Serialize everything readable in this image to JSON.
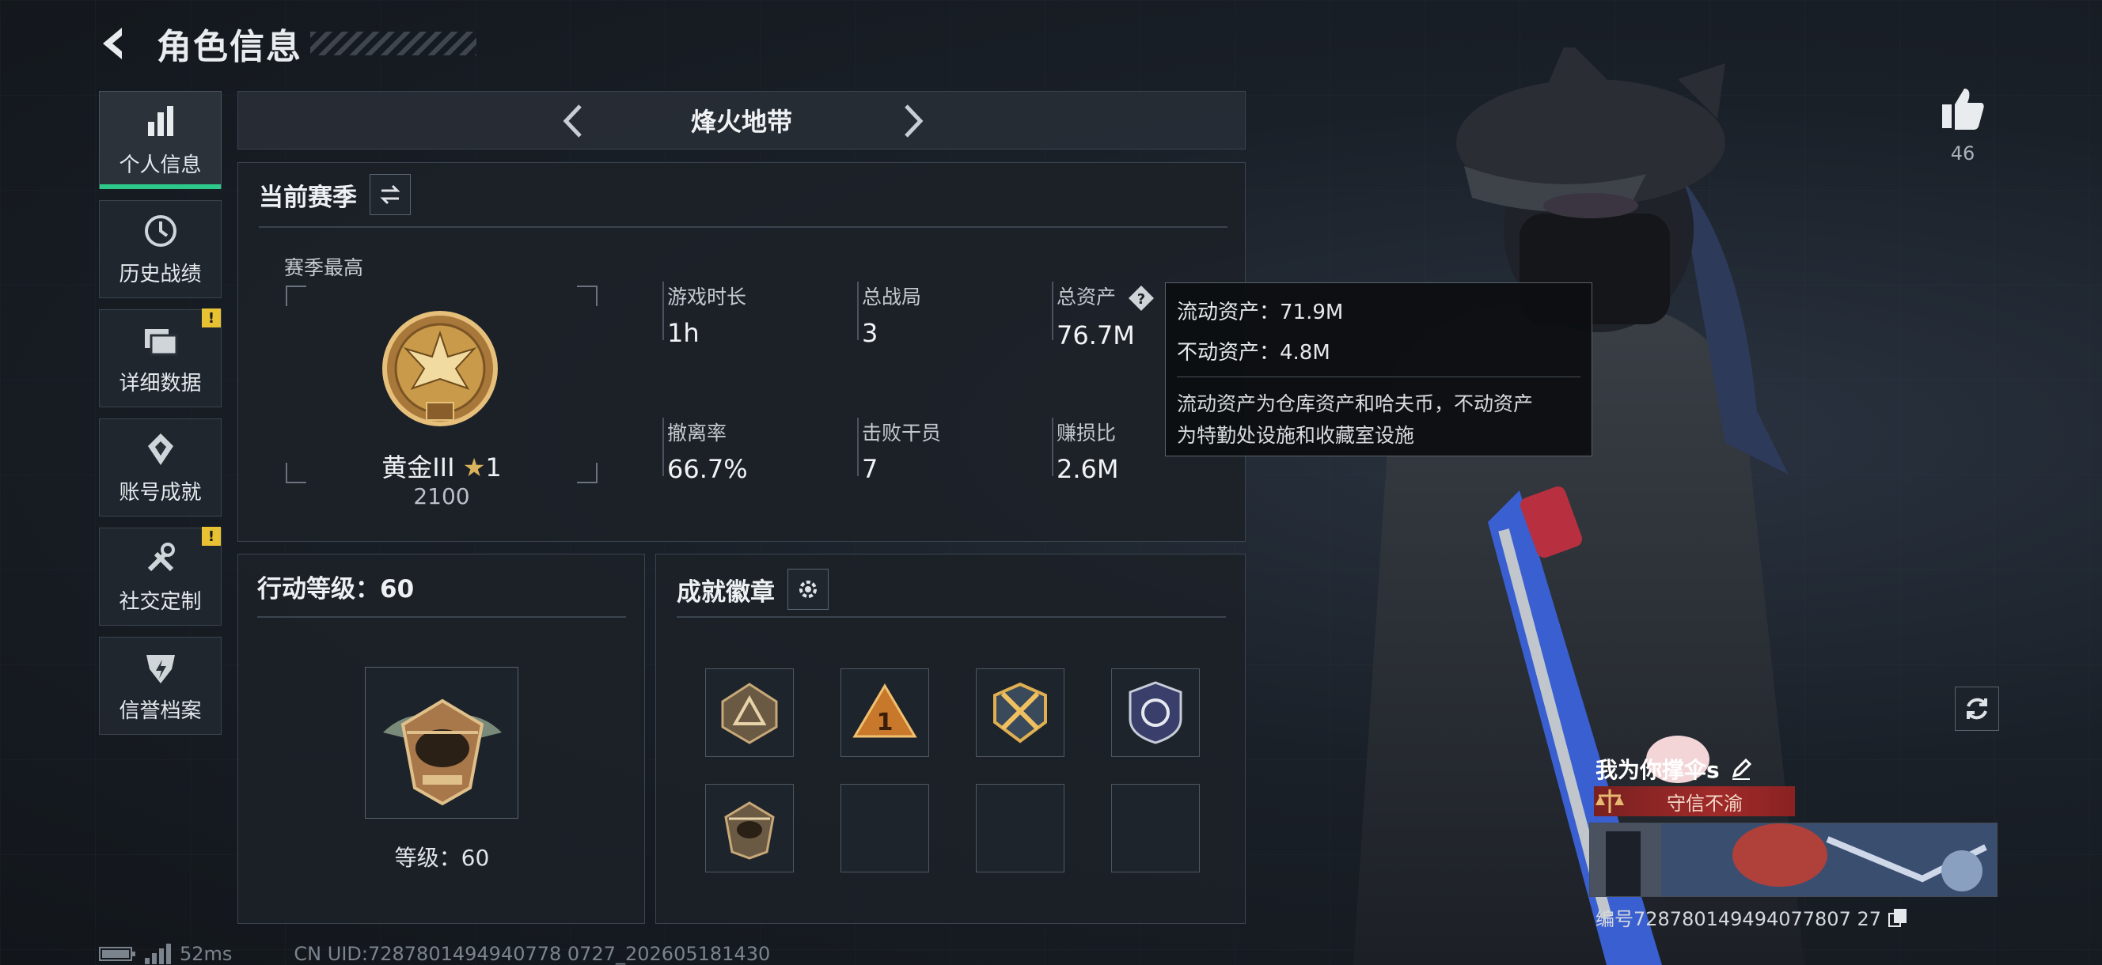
{
  "header": {
    "title": "角色信息"
  },
  "sidebar": {
    "items": [
      {
        "label": "个人信息",
        "icon": "bar-chart-icon",
        "active": true,
        "warning": false
      },
      {
        "label": "历史战绩",
        "icon": "clock-icon",
        "active": false,
        "warning": false
      },
      {
        "label": "详细数据",
        "icon": "folder-icon",
        "active": false,
        "warning": true
      },
      {
        "label": "账号成就",
        "icon": "medal-icon",
        "active": false,
        "warning": false
      },
      {
        "label": "社交定制",
        "icon": "tools-icon",
        "active": false,
        "warning": true
      },
      {
        "label": "信誉档案",
        "icon": "shield-icon",
        "active": false,
        "warning": false
      }
    ],
    "warning_mark": "!"
  },
  "mode": {
    "title": "烽火地带"
  },
  "season": {
    "title": "当前赛季",
    "best_label": "赛季最高",
    "rank_name": "黄金III",
    "rank_stars": "1",
    "rank_points": "2100",
    "stats": {
      "playtime": {
        "label": "游戏时长",
        "value": "1h"
      },
      "matches": {
        "label": "总战局",
        "value": "3"
      },
      "assets": {
        "label": "总资产",
        "value": "76.7M"
      },
      "extract_rate": {
        "label": "撤离率",
        "value": "66.7%"
      },
      "kills": {
        "label": "击败干员",
        "value": "7"
      },
      "profit_ratio": {
        "label": "赚损比",
        "value": "2.6M"
      }
    }
  },
  "tooltip": {
    "liquid": "流动资产：71.9M",
    "fixed": "不动资产：4.8M",
    "desc_1": "流动资产为仓库资产和哈夫币，不动资产",
    "desc_2": "为特勤处设施和收藏室设施"
  },
  "action_level": {
    "title": "行动等级：60",
    "level_text": "等级：60"
  },
  "achievements": {
    "title": "成就徽章",
    "badges": [
      "triangle-badge",
      "number-one-badge",
      "crossed-arrows-badge",
      "police-badge",
      "helicopter-badge",
      "empty",
      "empty",
      "empty"
    ]
  },
  "profile": {
    "likes": "46",
    "player_name": "我为你撑伞s",
    "title_badge": "守信不渝",
    "id_text": "编号728780149494077807 27"
  },
  "footer": {
    "ping": "52ms",
    "uid": "CN UID:7287801494940778 0727_202605181430"
  },
  "colors": {
    "accent_green": "#2ec98a",
    "warning_yellow": "#e8c233",
    "title_red": "#a02a2a",
    "gold": "#c89a4a"
  }
}
